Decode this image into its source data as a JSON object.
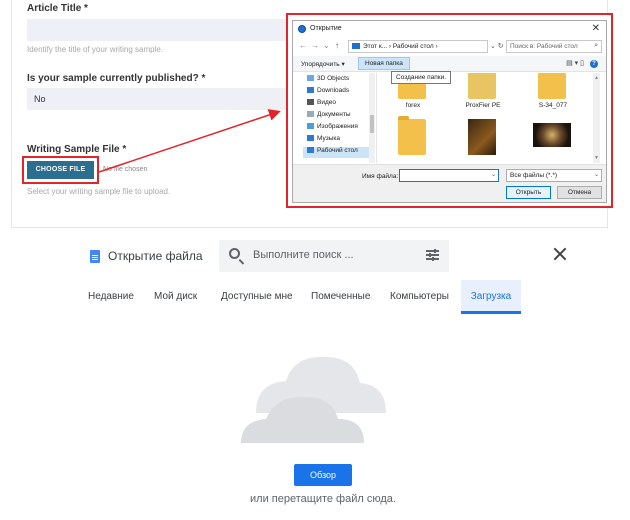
{
  "form": {
    "article_title_label": "Article Title *",
    "article_title_hint": "Identify the title of your writing sample.",
    "published_label": "Is your sample currently published? *",
    "published_value": "No",
    "file_label": "Writing Sample File *",
    "choose_file_label": "CHOOSE FILE",
    "no_file_text": "No file chosen",
    "file_hint": "Select your writing sample file to upload."
  },
  "dialog": {
    "title": "Открытие",
    "address": "Этот к... › Рабочий стол ›",
    "search_placeholder": "Поиск в: Рабочий стол",
    "organize_label": "Упорядочить ▾",
    "new_folder_label": "Новая папка",
    "tooltip": "Создание папки.",
    "sidebar": [
      "3D Objects",
      "Downloads",
      "Видео",
      "Документы",
      "Изображения",
      "Музыка",
      "Рабочий стол"
    ],
    "files": [
      {
        "name": "forex"
      },
      {
        "name": "ProxFier PE"
      },
      {
        "name": "S-34_077"
      },
      {
        "name": ""
      },
      {
        "name": ""
      },
      {
        "name": ""
      }
    ],
    "filename_label": "Имя файла:",
    "filename_value": "",
    "filter_value": "Все файлы (*.*)",
    "open_label": "Открыть",
    "cancel_label": "Отмена"
  },
  "picker": {
    "title": "Открытие файла",
    "search_placeholder": "Выполните поиск ...",
    "tabs": [
      "Недавние",
      "Мой диск",
      "Доступные мне",
      "Помеченные",
      "Компьютеры",
      "Загрузка"
    ],
    "active_tab": "Загрузка",
    "browse_label": "Обзор",
    "drop_text": "или перетащите файл сюда."
  },
  "colors": {
    "highlight_red": "#e0262b",
    "choose_file_bg": "#2a6f8f",
    "google_blue": "#1a73e8",
    "windows_blue": "#1e6fd0"
  }
}
